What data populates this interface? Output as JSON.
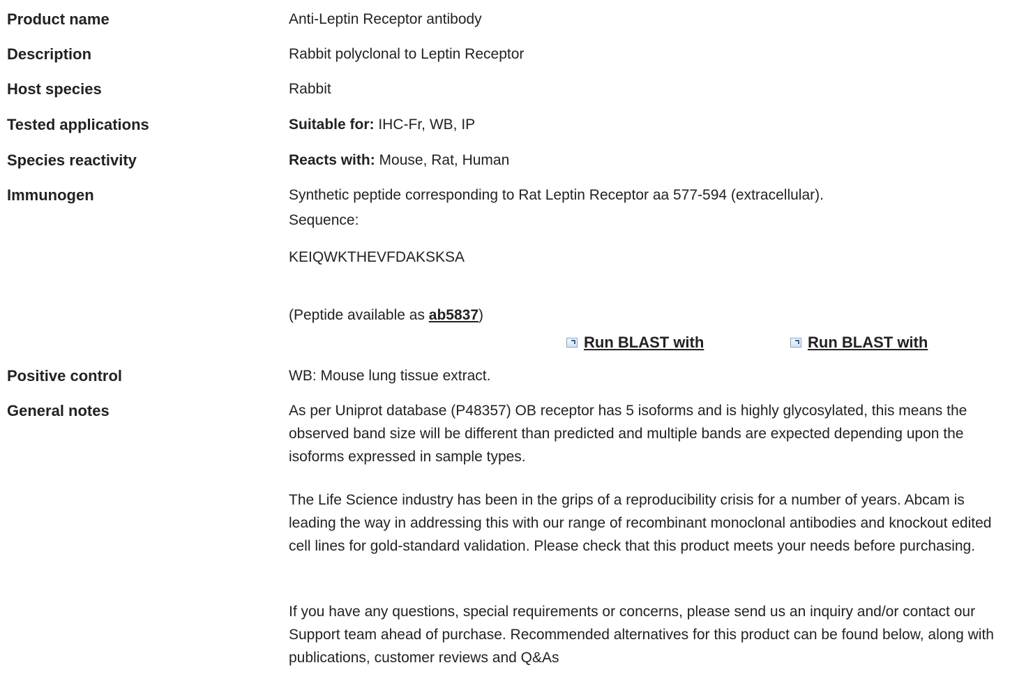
{
  "rows": {
    "product_name": {
      "label": "Product name",
      "value": "Anti-Leptin Receptor antibody"
    },
    "description": {
      "label": "Description",
      "value": "Rabbit polyclonal to Leptin Receptor"
    },
    "host_species": {
      "label": "Host species",
      "value": "Rabbit"
    },
    "tested_applications": {
      "label": "Tested applications",
      "prefix": "Suitable for:",
      "value": " IHC-Fr, WB, IP"
    },
    "species_reactivity": {
      "label": "Species reactivity",
      "prefix": "Reacts with:",
      "value": " Mouse, Rat, Human"
    },
    "immunogen": {
      "label": "Immunogen",
      "line1": "Synthetic peptide corresponding to Rat Leptin Receptor aa 577-594 (extracellular).",
      "line2": "Sequence:",
      "sequence": "KEIQWKTHEVFDAKSKSA",
      "peptide_prefix": "(Peptide available as ",
      "peptide_link": "ab5837",
      "peptide_suffix": ")",
      "blast_1": "Run BLAST with",
      "blast_2": "Run BLAST with"
    },
    "positive_control": {
      "label": "Positive control",
      "value": "WB: Mouse lung tissue extract."
    },
    "general_notes": {
      "label": "General notes",
      "paragraphs": [
        "As per Uniprot database (P48357) OB receptor has 5 isoforms and is highly glycosylated, this means the observed band size will be different than predicted and multiple bands are expected depending upon the isoforms expressed in sample types.",
        "The Life Science industry has been in the grips of a reproducibility crisis for a number of years. Abcam is leading the way in addressing this with our range of recombinant monoclonal antibodies and knockout edited cell lines for gold-standard validation. Please check that this product meets your needs before purchasing.",
        "If you have any questions, special requirements or concerns, please send us an inquiry and/or contact our Support team ahead of purchase. Recommended alternatives for this product can be found below, along with publications, customer reviews and Q&As"
      ]
    }
  }
}
